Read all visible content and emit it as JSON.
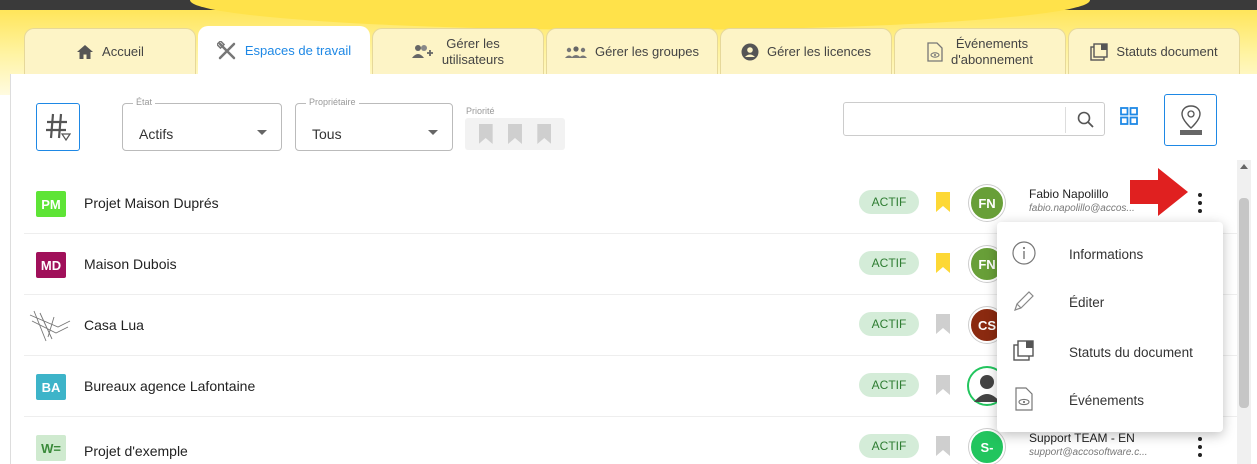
{
  "tabs": [
    {
      "label": "Accueil",
      "icon": "home-icon"
    },
    {
      "label": "Espaces de travail",
      "icon": "tools-icon",
      "active": true
    },
    {
      "label1": "Gérer les",
      "label2": "utilisateurs",
      "icon": "add-user-icon"
    },
    {
      "label": "Gérer les groupes",
      "icon": "group-icon"
    },
    {
      "label": "Gérer les licences",
      "icon": "account-icon"
    },
    {
      "label1": "Événements",
      "label2": "d'abonnement",
      "icon": "document-eye-icon"
    },
    {
      "label": "Statuts document",
      "icon": "document-status-icon"
    }
  ],
  "filters": {
    "etat_label": "État",
    "etat_value": "Actifs",
    "proprietaire_label": "Propriétaire",
    "proprietaire_value": "Tous",
    "priorite_label": "Priorité"
  },
  "rows": [
    {
      "initials": "PM",
      "color": "#5ee436",
      "name": "Projet Maison Duprés",
      "status": "ACTIF",
      "flag": "yellow",
      "person_initials": "FN",
      "person_color": "#689f38",
      "person_name": "Fabio Napolillo",
      "person_email": "fabio.napolillo@accos..."
    },
    {
      "initials": "MD",
      "color": "#a0105a",
      "name": "Maison Dubois",
      "status": "ACTIF",
      "flag": "yellow",
      "person_initials": "FN",
      "person_color": "#689f38",
      "person_name": "",
      "person_email": ""
    },
    {
      "initials": "",
      "color": "#ffffff",
      "name": "Casa Lua",
      "status": "ACTIF",
      "flag": "grey",
      "person_initials": "CS",
      "person_color": "#8b2a10",
      "person_name": "",
      "person_email": ""
    },
    {
      "initials": "BA",
      "color": "#3db4c9",
      "name": "Bureaux agence Lafontaine",
      "status": "ACTIF",
      "flag": "grey",
      "person_initials": "",
      "person_color": "#555555",
      "person_name": "",
      "person_email": ""
    },
    {
      "initials": "W=",
      "color": "#cfeacf",
      "name": "Projet d'exemple",
      "status": "ACTIF",
      "flag": "grey",
      "person_initials": "S-",
      "person_color": "#22c55e",
      "person_name": "Support TEAM - EN",
      "person_email": "support@accosoftware.c..."
    }
  ],
  "menu": [
    {
      "label": "Informations",
      "icon": "info-icon"
    },
    {
      "label": "Éditer",
      "icon": "pencil-icon"
    },
    {
      "label": "Statuts du document",
      "icon": "document-status-icon"
    },
    {
      "label": "Événements",
      "icon": "document-eye-icon"
    }
  ],
  "colors": {
    "accent": "#1e88e5",
    "banner": "#ffe24a",
    "badge_bg": "#d4ecd8",
    "arrow": "#e02020"
  }
}
